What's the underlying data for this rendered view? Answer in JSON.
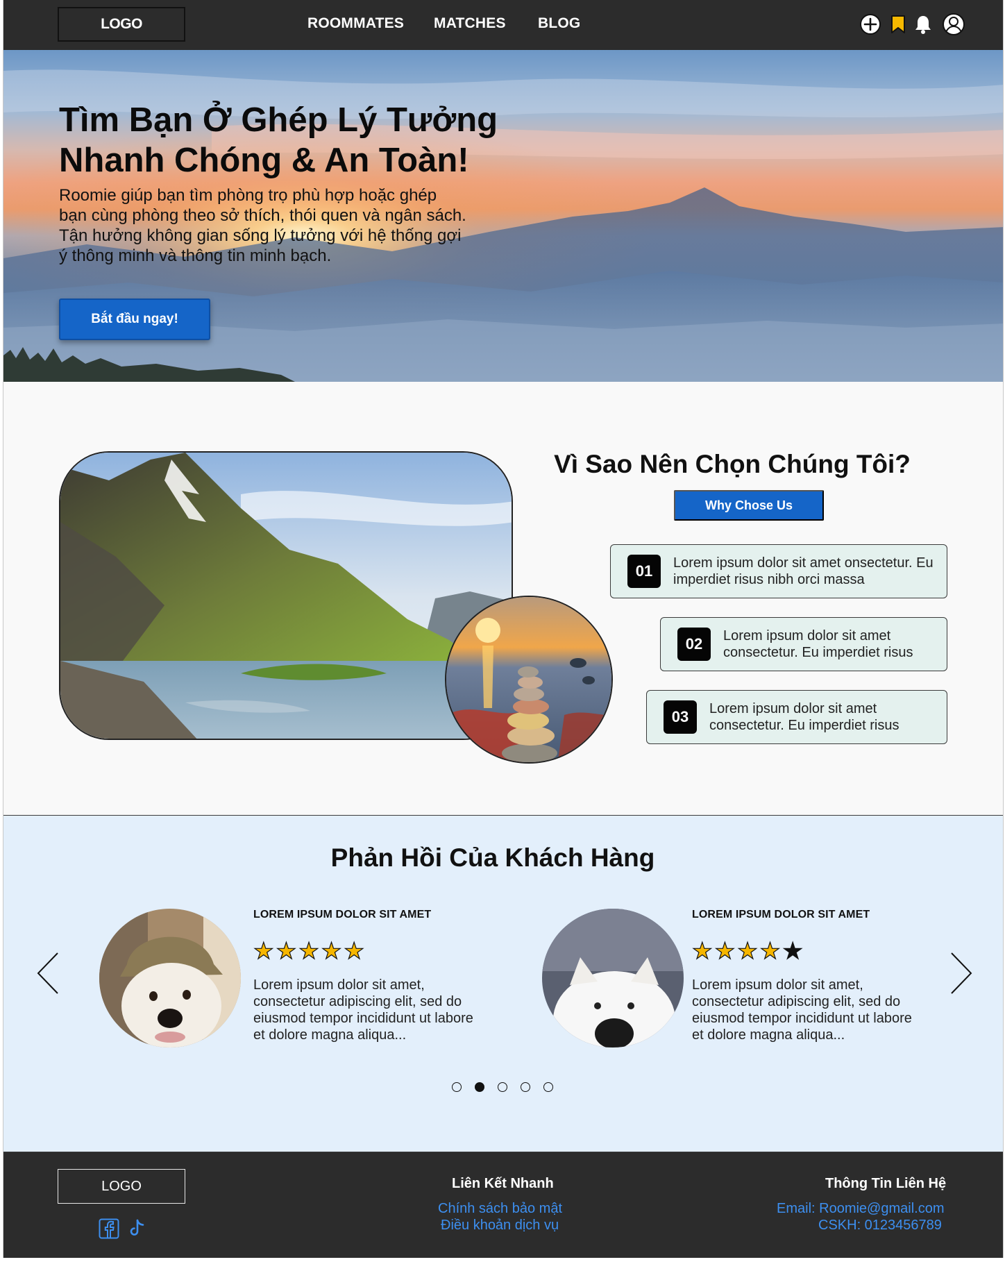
{
  "nav": {
    "logo": "LOGO",
    "links": [
      "ROOMMATES",
      "MATCHES",
      "BLOG"
    ],
    "icons": [
      "plus-circle-icon",
      "bookmark-icon",
      "bell-icon",
      "user-circle-icon"
    ]
  },
  "hero": {
    "title_line1": "Tìm Bạn Ở Ghép Lý Tưởng",
    "title_line2": "Nhanh Chóng & An Toàn!",
    "subtitle": "Roomie giúp bạn tìm phòng trọ phù hợp hoặc ghép bạn cùng phòng theo sở thích, thói quen và ngân sách. Tận hưởng không gian sống lý tưởng với hệ thống gợi ý thông minh và thông tin minh bạch.",
    "cta": "Bắt đầu ngay!"
  },
  "why": {
    "title": "Vì Sao Nên Chọn Chúng Tôi?",
    "button": "Why Chose Us",
    "features": [
      {
        "num": "01",
        "text": "Lorem ipsum dolor sit amet onsectetur. Eu imperdiet risus nibh orci massa"
      },
      {
        "num": "02",
        "text": "Lorem ipsum dolor sit amet consectetur. Eu imperdiet risus"
      },
      {
        "num": "03",
        "text": "Lorem ipsum dolor sit amet consectetur. Eu imperdiet risus"
      }
    ]
  },
  "testimonials": {
    "title": "Phản Hồi Của Khách Hàng",
    "reviews": [
      {
        "heading": "LOREM IPSUM DOLOR SIT AMET",
        "rating": 5,
        "text": "Lorem ipsum dolor sit amet, consectetur adipiscing elit, sed do eiusmod tempor incididunt ut labore et dolore magna aliqua..."
      },
      {
        "heading": "LOREM IPSUM DOLOR SIT AMET",
        "rating": 4,
        "text": "Lorem ipsum dolor sit amet, consectetur adipiscing elit, sed do eiusmod tempor incididunt ut labore et dolore magna aliqua..."
      }
    ],
    "active_dot": 2,
    "dot_count": 5
  },
  "footer": {
    "logo": "LOGO",
    "quick_links_title": "Liên Kết Nhanh",
    "quick_links": [
      "Chính sách bảo mật",
      "Điều khoản dịch vụ"
    ],
    "contact_title": "Thông Tin Liên Hệ",
    "email": "Email: Roomie@gmail.com",
    "phone": "CSKH: 0123456789",
    "social_icons": [
      "facebook-icon",
      "tiktok-icon"
    ]
  },
  "colors": {
    "nav_bg": "#2c2c2c",
    "primary_blue": "#1565c8",
    "feature_bg": "#e4f1ee",
    "testimonial_bg": "#e3effb",
    "star": "#f6b600",
    "footer_link": "#3d8ff0"
  }
}
